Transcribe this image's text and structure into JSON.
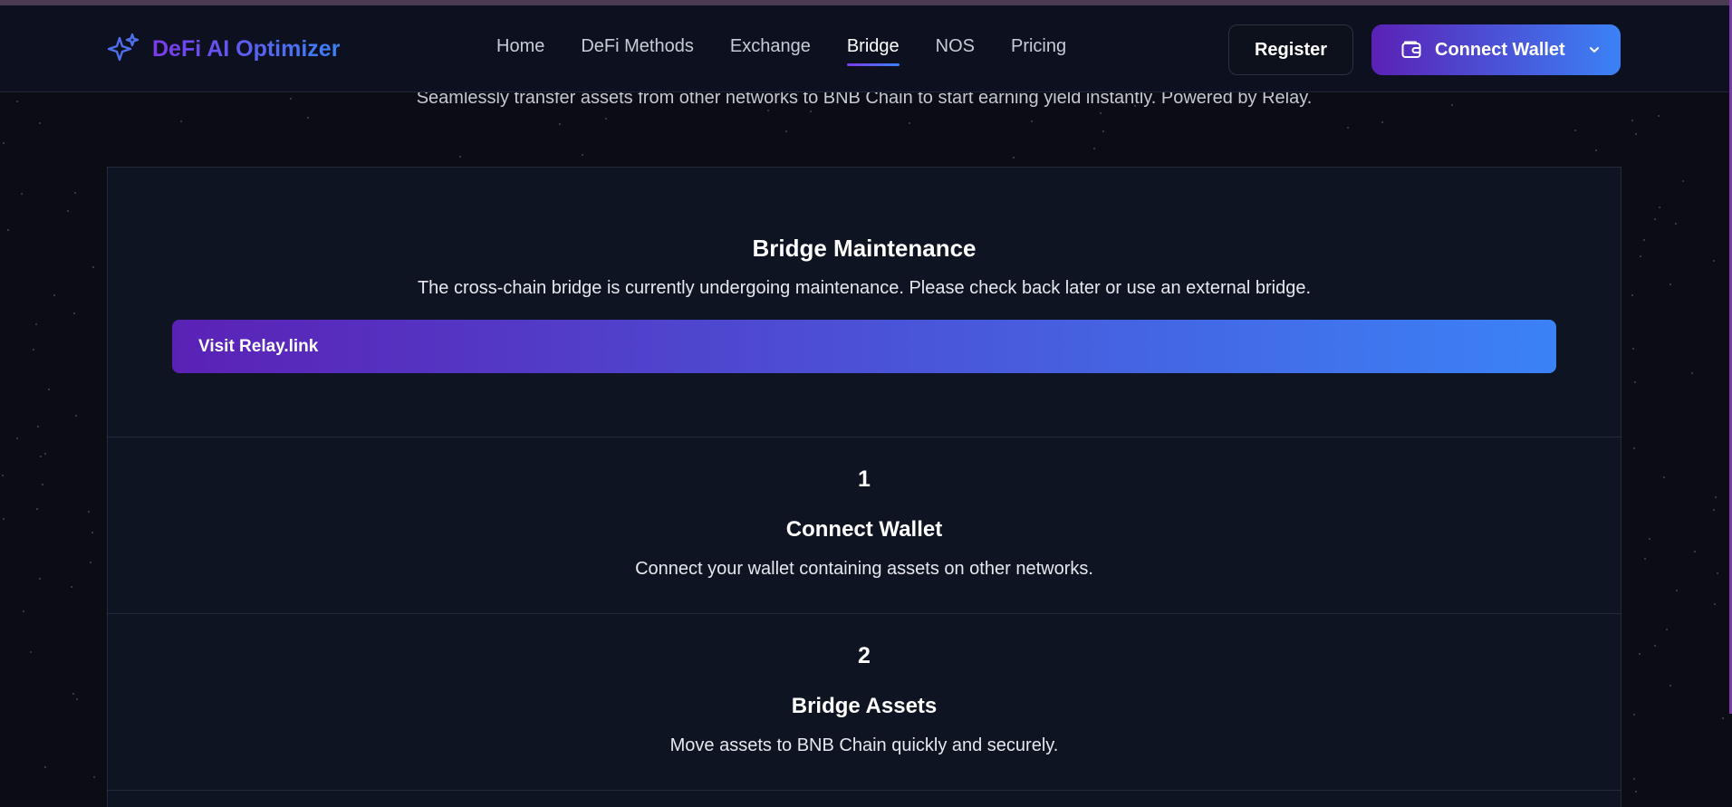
{
  "brand": {
    "name": "DeFi AI Optimizer",
    "icon": "sparkles-icon"
  },
  "nav": {
    "items": [
      {
        "label": "Home",
        "active": false
      },
      {
        "label": "DeFi Methods",
        "active": false
      },
      {
        "label": "Exchange",
        "active": false
      },
      {
        "label": "Bridge",
        "active": true
      },
      {
        "label": "NOS",
        "active": false
      },
      {
        "label": "Pricing",
        "active": false
      }
    ]
  },
  "header": {
    "register_label": "Register",
    "connect_label": "Connect Wallet",
    "connect_icon": "wallet-icon",
    "connect_chevron": "chevron-down-icon"
  },
  "page": {
    "subtitle": "Seamlessly transfer assets from other networks to BNB Chain to start earning yield instantly. Powered by Relay."
  },
  "maintenance": {
    "title": "Bridge Maintenance",
    "text": "The cross-chain bridge is currently undergoing maintenance. Please check back later or use an external bridge.",
    "button_label": "Visit Relay.link"
  },
  "steps": [
    {
      "number": "1",
      "title": "Connect Wallet",
      "description": "Connect your wallet containing assets on other networks."
    },
    {
      "number": "2",
      "title": "Bridge Assets",
      "description": "Move assets to BNB Chain quickly and securely."
    }
  ],
  "colors": {
    "background": "#0b0c14",
    "card": "#0f1422",
    "accent_start": "#5b21b6",
    "accent_end": "#3b82f6"
  }
}
